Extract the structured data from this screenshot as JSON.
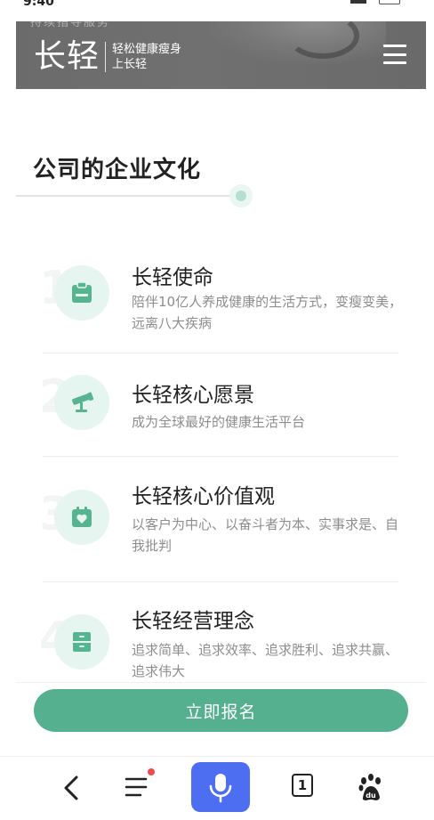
{
  "status_bar": {
    "time": "9:40"
  },
  "header": {
    "underlay_text": "持续指导服务",
    "logo_main": "长轻",
    "logo_sub_line1": "轻松健康瘦身",
    "logo_sub_line2": "上长轻",
    "menu_icon": "hamburger-menu-icon"
  },
  "section": {
    "title": "公司的企业文化"
  },
  "values": [
    {
      "number": "1",
      "icon": "clipboard-icon",
      "title": "长轻使命",
      "desc": "陪伴10亿人养成健康的生活方式，变瘦变美，远离八大疾病"
    },
    {
      "number": "2",
      "icon": "telescope-icon",
      "title": "长轻核心愿景",
      "desc": "成为全球最好的健康生活平台"
    },
    {
      "number": "3",
      "icon": "calendar-heart-icon",
      "title": "长轻核心价值观",
      "desc": "以客户为中心、以奋斗者为本、实事求是、自我批判"
    },
    {
      "number": "4",
      "icon": "cabinet-icon",
      "title": "长轻经营理念",
      "desc": "追求简单、追求效率、追求胜利、追求共赢、追求伟大"
    }
  ],
  "cta": {
    "label": "立即报名"
  },
  "browser_nav": {
    "tab_count": "1",
    "items": [
      "back-icon",
      "menu-icon",
      "voice-icon",
      "tabs-icon",
      "baidu-icon"
    ]
  },
  "colors": {
    "accent": "#54b08f",
    "icon_bg": "#e6f5ef",
    "voice_button": "#4e6ef2",
    "header_bg": "#6d6d6d",
    "notification_dot": "#f04a4a"
  }
}
